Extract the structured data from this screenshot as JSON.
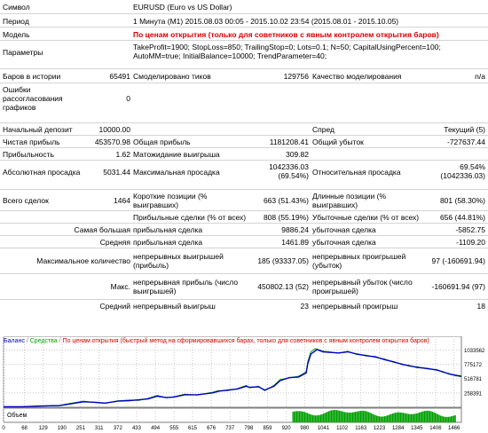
{
  "report": {
    "symbol": {
      "label": "Символ",
      "value": "EURUSD (Euro vs US Dollar)"
    },
    "period": {
      "label": "Период",
      "value": "1 Минута (M1) 2015.08.03 00:05 - 2015.10.02 23:54 (2015.08.01 - 2015.10.05)"
    },
    "model": {
      "label": "Модель",
      "value": "По ценам открытия (только для советников с явным контролем открытия баров)"
    },
    "params": {
      "label": "Параметры",
      "value": "TakeProfit=1900; StopLoss=850; TrailingStop=0; Lots=0.1; N=50; CapitalUsingPercent=100; AutoMM=true; InitialBalance=10000; TrendParameter=40;"
    },
    "bars": {
      "label": "Баров в истории",
      "value": "65491",
      "ticks_label": "Смоделировано тиков",
      "ticks_value": "129756",
      "quality_label": "Качество моделирования",
      "quality_value": "n/a"
    },
    "errors": {
      "label": "Ошибки рассогласования графиков",
      "value": "0"
    },
    "deposit": {
      "label": "Начальный депозит",
      "value": "10000.00",
      "spread_label": "Спред",
      "spread_value": "Текущий (5)"
    },
    "net": {
      "label": "Чистая прибыль",
      "value": "453570.98",
      "gross_profit_label": "Общая прибыль",
      "gross_profit_value": "1181208.41",
      "gross_loss_label": "Общий убыток",
      "gross_loss_value": "-727637.44"
    },
    "pf": {
      "label": "Прибыльность",
      "value": "1.62",
      "expected_label": "Матожидание выигрыша",
      "expected_value": "309.82"
    },
    "dd": {
      "label": "Абсолютная просадка",
      "value": "5031.44",
      "maximal_label": "Максимальная просадка",
      "maximal_value": "1042336.03 (69.54%)",
      "relative_label": "Относительная просадка",
      "relative_value": "69.54% (1042336.03)"
    },
    "trades": {
      "label": "Всего сделок",
      "value": "1464",
      "short_label": "Короткие позиции (% выигравших)",
      "short_value": "663 (51.43%)",
      "long_label": "Длинные позиции (% выигравших)",
      "long_value": "801 (58.30%)"
    },
    "win": {
      "profit_label": "Прибыльные сделки (% от всех)",
      "profit_value": "808 (55.19%)",
      "loss_label": "Убыточные сделки (% от всех)",
      "loss_value": "656 (44.81%)"
    },
    "largest": {
      "label": "Самая большая",
      "profit_label": "прибыльная сделка",
      "profit_value": "9886.24",
      "loss_label": "убыточная сделка",
      "loss_value": "-5852.75"
    },
    "average": {
      "label": "Средняя",
      "profit_label": "прибыльная сделка",
      "profit_value": "1461.89",
      "loss_label": "убыточная сделка",
      "loss_value": "-1109.20"
    },
    "max_count": {
      "label": "Максимальное количество",
      "wins_label": "непрерывных выигрышей (прибыль)",
      "wins_value": "185 (93337.05)",
      "losses_label": "непрерывных проигрышей (убыток)",
      "losses_value": "97 (-160691.94)"
    },
    "max_val": {
      "label": "Макс.",
      "profit_label": "непрерывная прибыль (число выигрышей)",
      "profit_value": "450802.13 (52)",
      "loss_label": "непрерывный убыток (число проигрышей)",
      "loss_value": "-160691.94 (97)"
    },
    "avg_cons": {
      "label": "Средний",
      "wins_label": "непрерывный выигрыш",
      "wins_value": "23",
      "losses_label": "непрерывный проигрыш",
      "losses_value": "18"
    }
  },
  "chart_legend": {
    "balance": "Баланс",
    "equity": "Средства",
    "mode": "По ценам открытия (быстрый метод на сформировавшихся барах, только для советников с явным контролем открытия баров)"
  },
  "volume_label": "Объем",
  "colors": {
    "balance": "#0000c0",
    "equity": "#00a000",
    "volume": "#00a000",
    "mode": "#d80000"
  },
  "chart_data": {
    "type": "line",
    "y_ticks": [
      "1033562",
      "775172",
      "516781",
      "258391"
    ],
    "x_ticks": [
      "0",
      "68",
      "129",
      "190",
      "251",
      "311",
      "372",
      "433",
      "494",
      "555",
      "615",
      "676",
      "737",
      "798",
      "859",
      "920",
      "980",
      "1041",
      "1102",
      "1163",
      "1223",
      "1284",
      "1345",
      "1406",
      "1466"
    ],
    "xlim": [
      0,
      1490
    ],
    "ylim": [
      0,
      1120000
    ],
    "balance": [
      [
        0,
        10000
      ],
      [
        60,
        10000
      ],
      [
        120,
        22000
      ],
      [
        180,
        30000
      ],
      [
        200,
        45000
      ],
      [
        260,
        100000
      ],
      [
        300,
        90000
      ],
      [
        330,
        75000
      ],
      [
        372,
        110000
      ],
      [
        410,
        120000
      ],
      [
        440,
        135000
      ],
      [
        470,
        150000
      ],
      [
        500,
        200000
      ],
      [
        530,
        175000
      ],
      [
        555,
        185000
      ],
      [
        590,
        225000
      ],
      [
        630,
        225000
      ],
      [
        680,
        260000
      ],
      [
        700,
        290000
      ],
      [
        730,
        310000
      ],
      [
        760,
        330000
      ],
      [
        790,
        380000
      ],
      [
        800,
        360000
      ],
      [
        830,
        370000
      ],
      [
        850,
        310000
      ],
      [
        880,
        380000
      ],
      [
        900,
        480000
      ],
      [
        930,
        535000
      ],
      [
        960,
        545000
      ],
      [
        985,
        620000
      ],
      [
        990,
        780000
      ],
      [
        1000,
        960000
      ],
      [
        1020,
        1040000
      ],
      [
        1040,
        1000000
      ],
      [
        1060,
        990000
      ],
      [
        1090,
        980000
      ],
      [
        1120,
        1000000
      ],
      [
        1150,
        960000
      ],
      [
        1180,
        930000
      ],
      [
        1210,
        910000
      ],
      [
        1240,
        860000
      ],
      [
        1270,
        820000
      ],
      [
        1300,
        770000
      ],
      [
        1320,
        750000
      ],
      [
        1345,
        720000
      ],
      [
        1380,
        700000
      ],
      [
        1410,
        670000
      ],
      [
        1430,
        640000
      ],
      [
        1450,
        600000
      ],
      [
        1470,
        580000
      ],
      [
        1490,
        560000
      ]
    ],
    "equity": [
      [
        0,
        10000
      ],
      [
        60,
        10000
      ],
      [
        120,
        22000
      ],
      [
        180,
        25000
      ],
      [
        200,
        55000
      ],
      [
        260,
        110000
      ],
      [
        300,
        85000
      ],
      [
        330,
        70000
      ],
      [
        372,
        115000
      ],
      [
        410,
        130000
      ],
      [
        440,
        125000
      ],
      [
        470,
        160000
      ],
      [
        500,
        215000
      ],
      [
        530,
        170000
      ],
      [
        555,
        190000
      ],
      [
        590,
        235000
      ],
      [
        630,
        220000
      ],
      [
        680,
        270000
      ],
      [
        700,
        300000
      ],
      [
        730,
        300000
      ],
      [
        760,
        335000
      ],
      [
        790,
        395000
      ],
      [
        800,
        350000
      ],
      [
        830,
        380000
      ],
      [
        850,
        300000
      ],
      [
        880,
        395000
      ],
      [
        900,
        500000
      ],
      [
        930,
        530000
      ],
      [
        960,
        560000
      ],
      [
        985,
        640000
      ],
      [
        990,
        820000
      ],
      [
        1000,
        1000000
      ],
      [
        1015,
        1060000
      ],
      [
        1040,
        1010000
      ],
      [
        1060,
        1000000
      ],
      [
        1090,
        975000
      ],
      [
        1120,
        1010000
      ],
      [
        1150,
        950000
      ],
      [
        1180,
        940000
      ],
      [
        1210,
        900000
      ],
      [
        1240,
        870000
      ],
      [
        1270,
        810000
      ],
      [
        1300,
        780000
      ],
      [
        1320,
        740000
      ],
      [
        1345,
        730000
      ],
      [
        1380,
        690000
      ],
      [
        1410,
        680000
      ],
      [
        1430,
        630000
      ],
      [
        1450,
        610000
      ],
      [
        1470,
        570000
      ],
      [
        1490,
        550000
      ]
    ],
    "volume_start_trade": 940,
    "volume_end_trade": 1470
  }
}
